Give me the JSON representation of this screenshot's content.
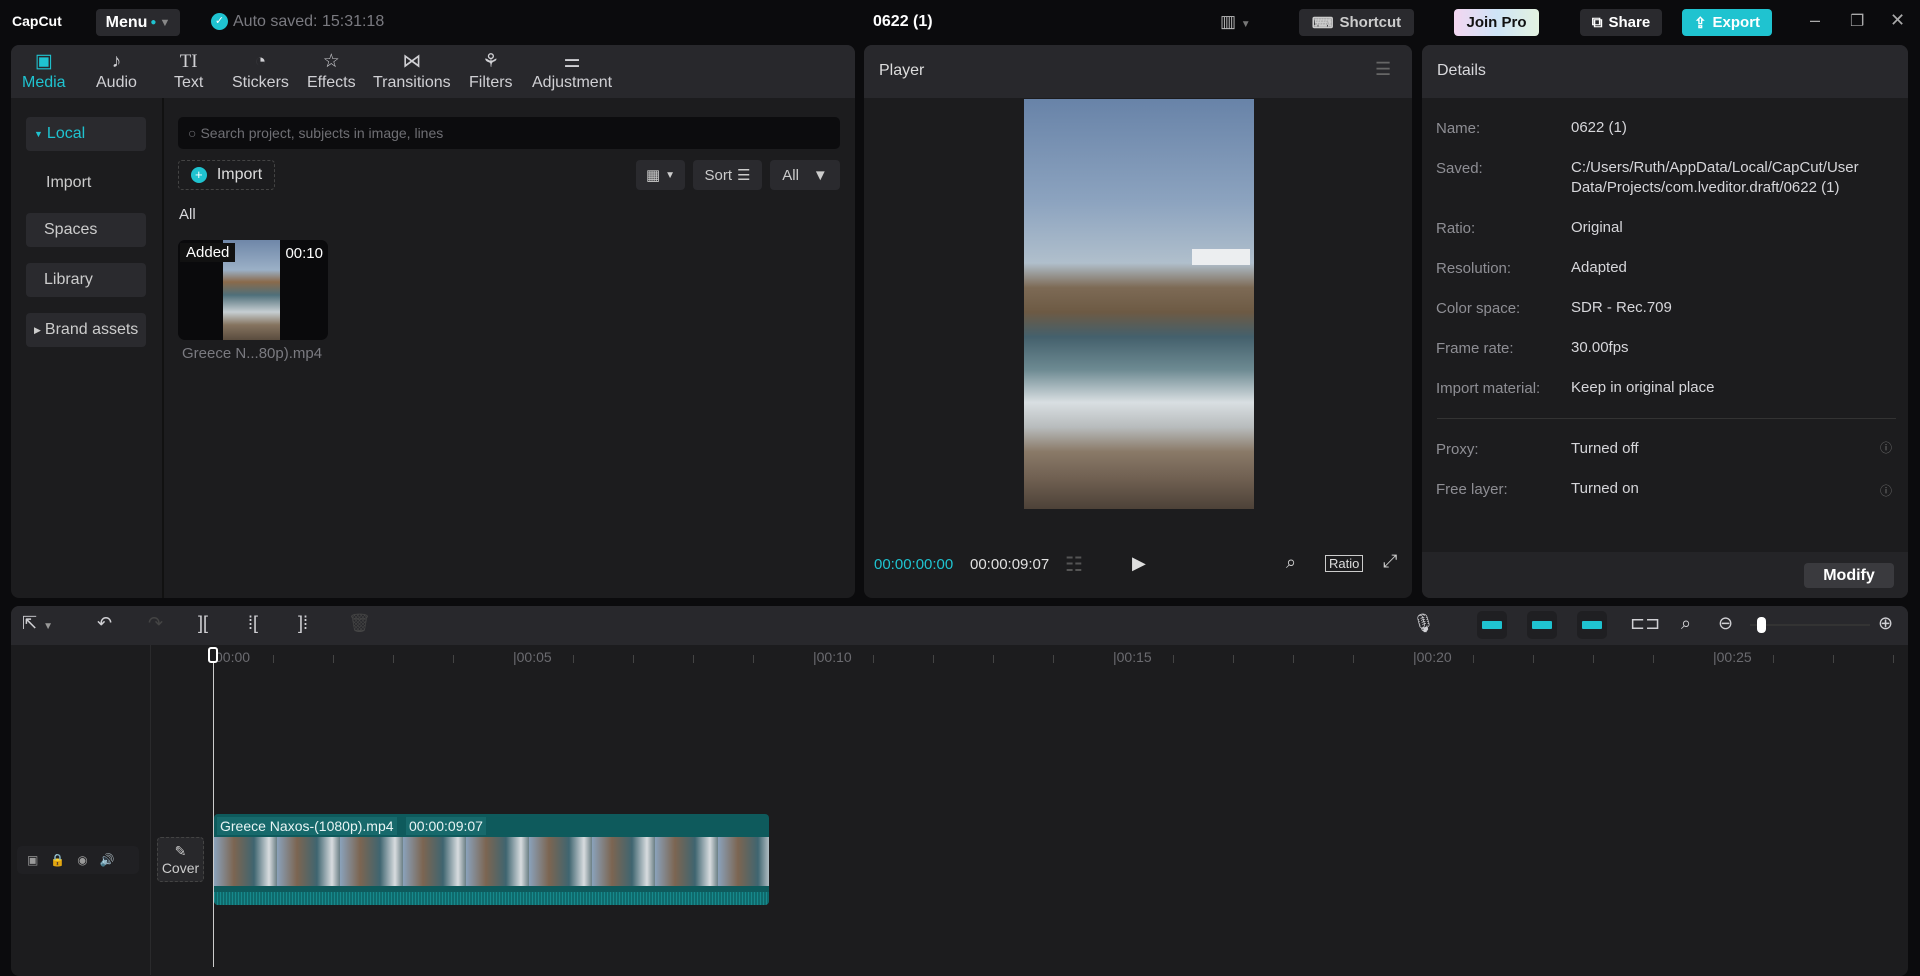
{
  "app": {
    "logo": "CapCut",
    "menu_label": "Menu",
    "autosave": "Auto saved: 15:31:18",
    "project_title": "0622 (1)",
    "shortcut_label": "Shortcut",
    "join_pro_label": "Join Pro",
    "share_label": "Share",
    "export_label": "Export",
    "accent": "#1fc3d0"
  },
  "media_tabs": [
    {
      "label": "Media",
      "icon": "media-icon"
    },
    {
      "label": "Audio",
      "icon": "audio-icon"
    },
    {
      "label": "Text",
      "icon": "text-icon"
    },
    {
      "label": "Stickers",
      "icon": "sticker-icon"
    },
    {
      "label": "Effects",
      "icon": "effects-icon"
    },
    {
      "label": "Transitions",
      "icon": "transitions-icon"
    },
    {
      "label": "Filters",
      "icon": "filters-icon"
    },
    {
      "label": "Adjustment",
      "icon": "adjustment-icon"
    }
  ],
  "sidebar": {
    "items": [
      {
        "label": "Local"
      },
      {
        "label": "Import"
      },
      {
        "label": "Spaces"
      },
      {
        "label": "Library"
      },
      {
        "label": "Brand assets"
      }
    ]
  },
  "media": {
    "search_placeholder": "Search project, subjects in image, lines",
    "import_label": "Import",
    "sort_label": "Sort",
    "filter_label": "All",
    "section_label": "All",
    "items": [
      {
        "badge": "Added",
        "duration": "00:10",
        "name": "Greece N...80p).mp4"
      }
    ]
  },
  "player": {
    "title": "Player",
    "current_time": "00:00:00:00",
    "total_time": "00:00:09:07",
    "ratio_label": "Ratio"
  },
  "details": {
    "title": "Details",
    "rows": [
      {
        "label": "Name:",
        "value": "0622 (1)"
      },
      {
        "label": "Saved:",
        "value": "C:/Users/Ruth/AppData/Local/CapCut/User Data/Projects/com.lveditor.draft/0622 (1)"
      },
      {
        "label": "Ratio:",
        "value": "Original"
      },
      {
        "label": "Resolution:",
        "value": "Adapted"
      },
      {
        "label": "Color space:",
        "value": "SDR - Rec.709"
      },
      {
        "label": "Frame rate:",
        "value": "30.00fps"
      },
      {
        "label": "Import material:",
        "value": "Keep in original place"
      },
      {
        "label": "Proxy:",
        "value": "Turned off"
      },
      {
        "label": "Free layer:",
        "value": "Turned on"
      }
    ],
    "modify_label": "Modify"
  },
  "timeline": {
    "ruler": [
      "00:00",
      "|00:05",
      "|00:10",
      "|00:15",
      "|00:20",
      "|00:25"
    ],
    "cover_label": "Cover",
    "clip": {
      "name": "Greece Naxos-(1080p).mp4",
      "duration": "00:00:09:07"
    }
  }
}
